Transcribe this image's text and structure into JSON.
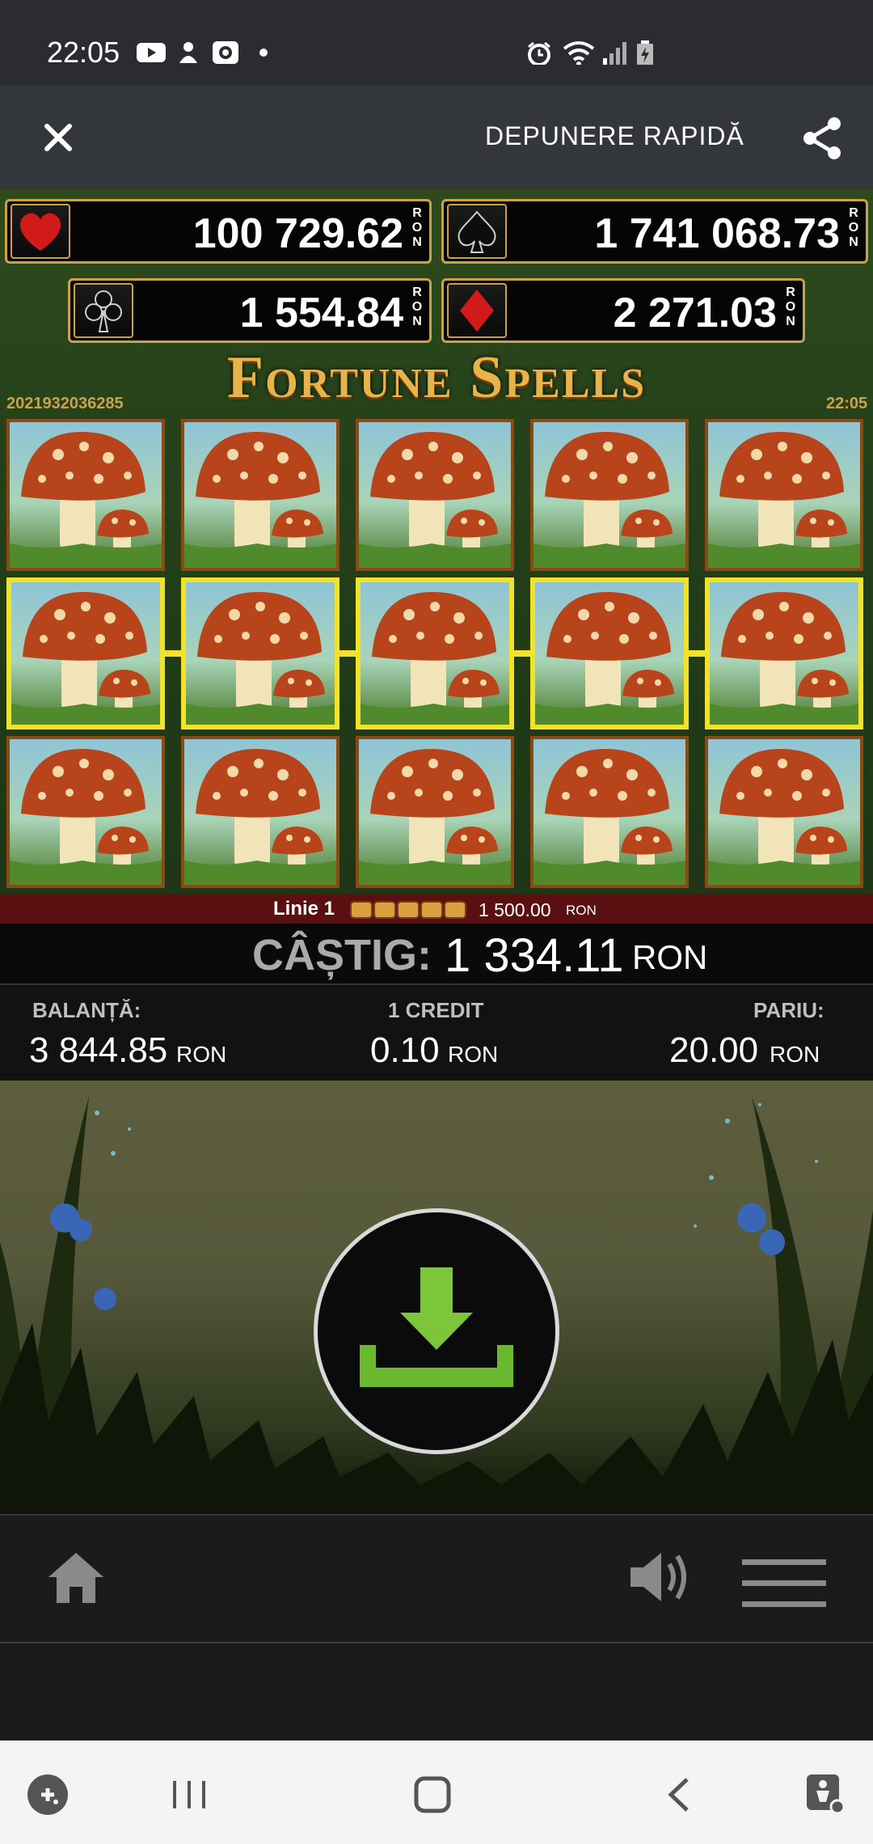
{
  "status_bar": {
    "time": "22:05"
  },
  "app_bar": {
    "title": "DEPUNERE RAPIDĂ"
  },
  "jackpots": {
    "hearts": {
      "value": "100 729.62",
      "currency": "RON"
    },
    "spades": {
      "value": "1 741 068.73",
      "currency": "RON"
    },
    "clubs": {
      "value": "1 554.84",
      "currency": "RON"
    },
    "diamonds": {
      "value": "2 271.03",
      "currency": "RON"
    }
  },
  "game": {
    "title": "Fortune Spells",
    "round_id": "2021932036285",
    "clock": "22:05",
    "reels": [
      [
        "mushroom",
        "mushroom",
        "mushroom"
      ],
      [
        "mushroom",
        "mushroom",
        "mushroom"
      ],
      [
        "mushroom",
        "mushroom",
        "mushroom"
      ],
      [
        "mushroom",
        "mushroom",
        "mushroom"
      ],
      [
        "mushroom",
        "mushroom",
        "mushroom"
      ]
    ],
    "line_win": {
      "label": "Linie 1",
      "amount": "1 500.00",
      "currency": "RON"
    }
  },
  "win": {
    "label": "CÂȘTIG:",
    "amount": "1 334.11",
    "currency": "RON"
  },
  "balance": {
    "label": "BALANȚĂ:",
    "amount": "3 844.85",
    "currency": "RON"
  },
  "credit": {
    "label": "1 CREDIT",
    "amount": "0.10",
    "currency": "RON"
  },
  "bet": {
    "label": "PARIU:",
    "amount": "20.00",
    "currency": "RON"
  },
  "colors": {
    "accent_gold": "#c9a24a",
    "win_line": "#f2e22a",
    "download_green": "#7cc63a"
  },
  "icons": [
    "youtube-icon",
    "notification-icon",
    "app-icon",
    "alarm-icon",
    "wifi-icon",
    "signal-icon",
    "battery-icon",
    "close-icon",
    "share-icon",
    "heart-icon",
    "spade-icon",
    "club-icon",
    "diamond-icon",
    "download-icon",
    "home-icon",
    "volume-icon",
    "menu-icon",
    "game-launcher-icon",
    "recent-apps-icon",
    "home-nav-icon",
    "back-icon",
    "accessibility-icon"
  ]
}
